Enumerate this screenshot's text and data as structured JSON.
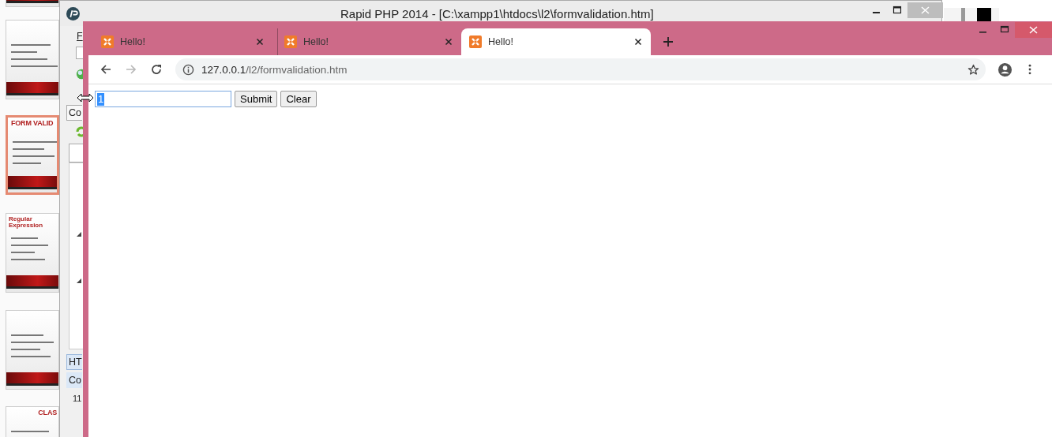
{
  "slides": [
    {
      "selected": false
    },
    {
      "selected": false
    },
    {
      "title": "FORM VALID",
      "selected": true
    },
    {
      "title": "Regular Expression",
      "selected": false
    },
    {
      "selected": false
    },
    {
      "title": "CLAS",
      "selected": false
    }
  ],
  "editor": {
    "title": "Rapid PHP 2014 - [C:\\xampp1\\htdocs\\l2\\formvalidation.htm]",
    "side_labels": [
      "F",
      "Co",
      "HT",
      "Co",
      "11"
    ]
  },
  "browser": {
    "tabs": [
      {
        "title": "Hello!",
        "selected": false
      },
      {
        "title": "Hello!",
        "selected": false
      },
      {
        "title": "Hello!",
        "selected": true
      }
    ],
    "forward_disabled": true,
    "address": {
      "host": "127.0.0.1",
      "path": "/l2/formvalidation.htm"
    },
    "form": {
      "value": "1",
      "buttons": [
        "Submit",
        "Clear"
      ]
    }
  }
}
